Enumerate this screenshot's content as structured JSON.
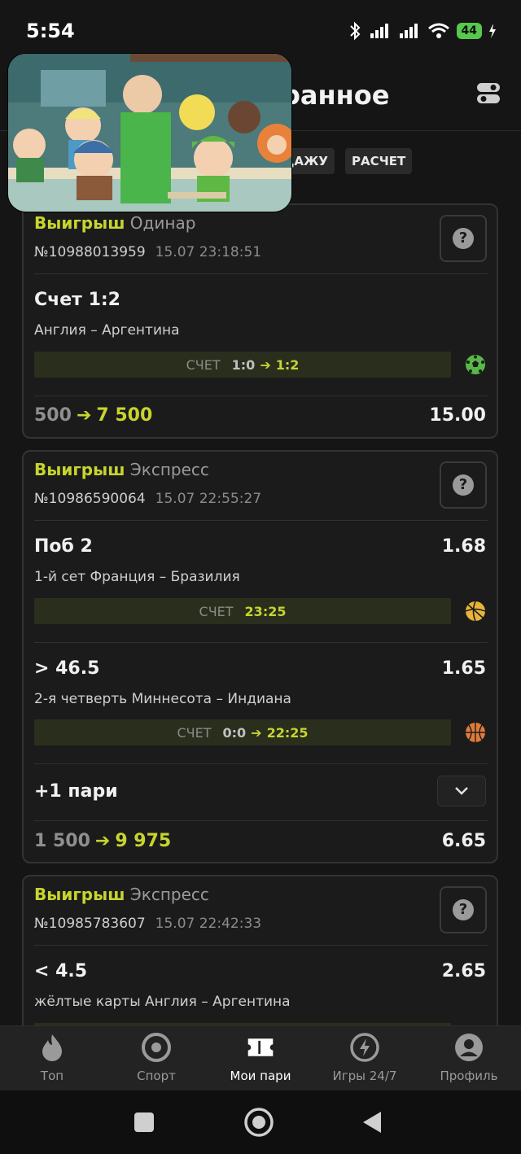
{
  "status_bar": {
    "time": "5:54",
    "battery": "44"
  },
  "header": {
    "title_visible": "ранное"
  },
  "filters": [
    {
      "label": "ДАЖУ"
    },
    {
      "label": "РАСЧЕТ"
    }
  ],
  "score_label": "СЧЕТ",
  "bets": [
    {
      "status": "Выигрыш",
      "type": "Одинар",
      "number": "№10988013959",
      "datetime": "15.07 23:18:51",
      "help": "?",
      "picks": [
        {
          "title": "Счет 1:2",
          "odds": "",
          "match": "Англия – Аргентина",
          "score_before": "1:0",
          "score_after": "1:2",
          "sport_icon": "football-icon"
        }
      ],
      "stake": "500",
      "payout": "7 500",
      "total_odds": "15.00"
    },
    {
      "status": "Выигрыш",
      "type": "Экспресс",
      "number": "№10986590064",
      "datetime": "15.07 22:55:27",
      "help": "?",
      "picks": [
        {
          "title": "Поб 2",
          "odds": "1.68",
          "match": "1-й сет Франция – Бразилия",
          "score_before": "",
          "score_after": "23:25",
          "sport_icon": "volleyball-icon"
        },
        {
          "title": "> 46.5",
          "odds": "1.65",
          "match": "2-я четверть Миннесота – Индиана",
          "score_before": "0:0",
          "score_after": "22:25",
          "sport_icon": "basketball-icon"
        }
      ],
      "more": "+1 пари",
      "stake": "1 500",
      "payout": "9 975",
      "total_odds": "6.65"
    },
    {
      "status": "Выигрыш",
      "type": "Экспресс",
      "number": "№10985783607",
      "datetime": "15.07 22:42:33",
      "help": "?",
      "picks": [
        {
          "title": "< 4.5",
          "odds": "2.65",
          "match": "жёлтые карты Англия – Аргентина"
        }
      ]
    }
  ],
  "nav": [
    {
      "label": "Топ",
      "icon": "flame-icon"
    },
    {
      "label": "Спорт",
      "icon": "target-icon"
    },
    {
      "label": "Мои пари",
      "icon": "ticket-icon",
      "active": true
    },
    {
      "label": "Игры 24/7",
      "icon": "lightning-icon"
    },
    {
      "label": "Профиль",
      "icon": "user-icon"
    }
  ],
  "colors": {
    "accent": "#c7d52e",
    "background": "#151515",
    "card": "#1b1b1b"
  }
}
